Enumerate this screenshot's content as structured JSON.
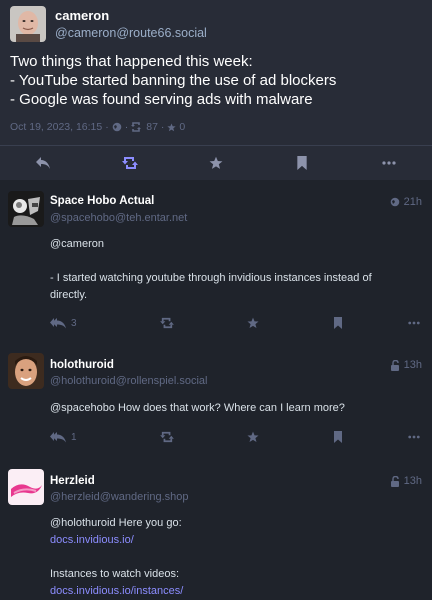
{
  "main": {
    "display_name": "cameron",
    "acct": "@cameron@route66.social",
    "text_lines": [
      "Two things that happened this week:",
      "- YouTube started banning the use of ad blockers",
      "- Google was found serving ads with malware"
    ],
    "date": "Oct 19, 2023, 16:15",
    "boosts": "87",
    "favourites": "0"
  },
  "replies": [
    {
      "display_name": "Space Hobo Actual",
      "acct": "@spacehobo@teh.entar.net",
      "time": "21h",
      "lines": [
        "@cameron",
        "",
        "- I started watching youtube through invidious instances instead of",
        "directly."
      ],
      "reply_count": "3"
    },
    {
      "display_name": "holothuroid",
      "acct": "@holothuroid@rollenspiel.social",
      "time": "13h",
      "lines": [
        "@spacehobo How does that work? Where can I learn more?"
      ],
      "reply_count": "1"
    },
    {
      "display_name": "Herzleid",
      "acct": "@herzleid@wandering.shop",
      "time": "13h",
      "lines": [
        "@holothuroid Here you go:",
        "docs.invidious.io/",
        "",
        "Instances to watch videos:",
        "docs.invidious.io/instances/"
      ]
    }
  ],
  "icons": {
    "reply": "reply-icon",
    "boost": "boost-icon",
    "star": "star-icon",
    "bookmark": "bookmark-icon",
    "more": "more-icon",
    "globe": "globe-icon",
    "lock": "unlock-icon"
  },
  "colors": {
    "background": "#1f232b",
    "main_card": "#282c37",
    "accent": "#8c8dff",
    "muted": "#606984",
    "secondary": "#9baec8"
  }
}
